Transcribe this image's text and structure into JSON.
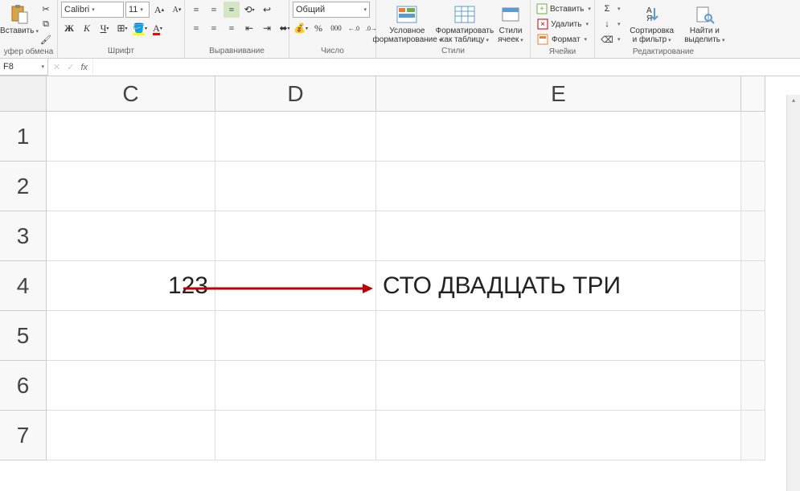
{
  "ribbon": {
    "clipboard": {
      "paste": "Вставить",
      "label": "уфер обмена"
    },
    "font": {
      "name": "Calibri",
      "size": "11",
      "label": "Шрифт"
    },
    "alignment": {
      "label": "Выравнивание"
    },
    "number": {
      "format": "Общий",
      "label": "Число"
    },
    "styles": {
      "cond": "Условное форматирование",
      "table": "Форматировать как таблицу",
      "cell": "Стили ячеек",
      "label": "Стили"
    },
    "cells": {
      "insert": "Вставить",
      "delete": "Удалить",
      "format": "Формат",
      "label": "Ячейки"
    },
    "editing": {
      "sort": "Сортировка и фильтр",
      "find": "Найти и выделить",
      "label": "Редактирование"
    }
  },
  "formula_bar": {
    "name_box": "F8",
    "fx": "fx",
    "value": ""
  },
  "grid": {
    "cols": [
      "C",
      "D",
      "E"
    ],
    "rows": [
      "1",
      "2",
      "3",
      "4",
      "5",
      "6",
      "7"
    ],
    "c4": "123",
    "e4": "СТО ДВАДЦАТЬ ТРИ"
  }
}
